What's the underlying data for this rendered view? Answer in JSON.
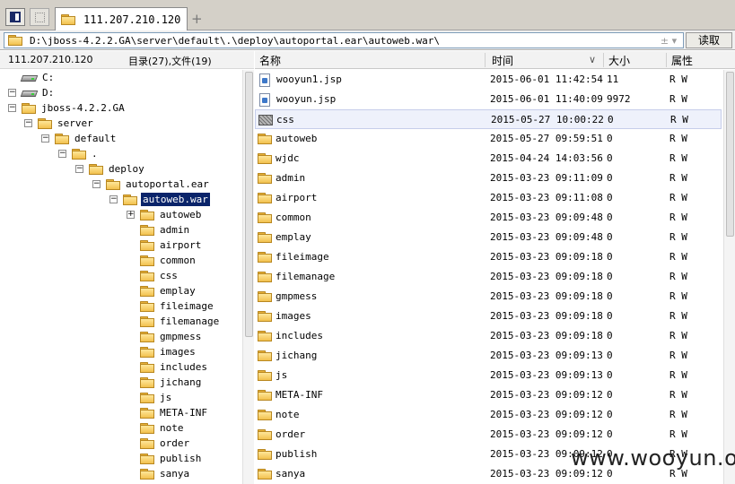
{
  "tab": {
    "title": "111.207.210.120",
    "add_label": "+"
  },
  "address": {
    "path": "D:\\jboss-4.2.2.GA\\server\\default\\.\\deploy\\autoportal.ear\\autoweb.war\\",
    "dropdown_glyph": "±  ▾",
    "read_button": "读取"
  },
  "status": {
    "host": "111.207.210.120",
    "counts": "目录(27),文件(19)"
  },
  "columns": {
    "name": "名称",
    "time": "时间",
    "size": "大小",
    "attr": "属性"
  },
  "tree": [
    {
      "label": "C:",
      "type": "drive",
      "exp": ""
    },
    {
      "label": "D:",
      "type": "drive",
      "exp": "−"
    },
    {
      "label": "jboss-4.2.2.GA",
      "type": "folder",
      "exp": "−"
    },
    {
      "label": "server",
      "type": "folder",
      "exp": "−"
    },
    {
      "label": "default",
      "type": "folder",
      "exp": "−"
    },
    {
      "label": ".",
      "type": "folder",
      "exp": "−"
    },
    {
      "label": "deploy",
      "type": "folder",
      "exp": "−"
    },
    {
      "label": "autoportal.ear",
      "type": "folder",
      "exp": "−"
    },
    {
      "label": "autoweb.war",
      "type": "folder",
      "exp": "−",
      "selected": true
    },
    {
      "label": "autoweb",
      "type": "folder",
      "exp": "+"
    },
    {
      "label": "admin",
      "type": "folder",
      "exp": ""
    },
    {
      "label": "airport",
      "type": "folder",
      "exp": ""
    },
    {
      "label": "common",
      "type": "folder",
      "exp": ""
    },
    {
      "label": "css",
      "type": "folder",
      "exp": ""
    },
    {
      "label": "emplay",
      "type": "folder",
      "exp": ""
    },
    {
      "label": "fileimage",
      "type": "folder",
      "exp": ""
    },
    {
      "label": "filemanage",
      "type": "folder",
      "exp": ""
    },
    {
      "label": "gmpmess",
      "type": "folder",
      "exp": ""
    },
    {
      "label": "images",
      "type": "folder",
      "exp": ""
    },
    {
      "label": "includes",
      "type": "folder",
      "exp": ""
    },
    {
      "label": "jichang",
      "type": "folder",
      "exp": ""
    },
    {
      "label": "js",
      "type": "folder",
      "exp": ""
    },
    {
      "label": "META-INF",
      "type": "folder",
      "exp": ""
    },
    {
      "label": "note",
      "type": "folder",
      "exp": ""
    },
    {
      "label": "order",
      "type": "folder",
      "exp": ""
    },
    {
      "label": "publish",
      "type": "folder",
      "exp": ""
    },
    {
      "label": "sanya",
      "type": "folder",
      "exp": ""
    }
  ],
  "files": [
    {
      "name": "wooyun1.jsp",
      "type": "file",
      "time": "2015-06-01 11:42:54",
      "size": "11",
      "attr": "R W"
    },
    {
      "name": "wooyun.jsp",
      "type": "file",
      "time": "2015-06-01 11:40:09",
      "size": "9972",
      "attr": "R W"
    },
    {
      "name": "css",
      "type": "css",
      "time": "2015-05-27 10:00:22",
      "size": "0",
      "attr": "R W",
      "highlight": true
    },
    {
      "name": "autoweb",
      "type": "folder",
      "time": "2015-05-27 09:59:51",
      "size": "0",
      "attr": "R W"
    },
    {
      "name": "wjdc",
      "type": "folder",
      "time": "2015-04-24 14:03:56",
      "size": "0",
      "attr": "R W"
    },
    {
      "name": "admin",
      "type": "folder",
      "time": "2015-03-23 09:11:09",
      "size": "0",
      "attr": "R W"
    },
    {
      "name": "airport",
      "type": "folder",
      "time": "2015-03-23 09:11:08",
      "size": "0",
      "attr": "R W"
    },
    {
      "name": "common",
      "type": "folder",
      "time": "2015-03-23 09:09:48",
      "size": "0",
      "attr": "R W"
    },
    {
      "name": "emplay",
      "type": "folder",
      "time": "2015-03-23 09:09:48",
      "size": "0",
      "attr": "R W"
    },
    {
      "name": "fileimage",
      "type": "folder",
      "time": "2015-03-23 09:09:18",
      "size": "0",
      "attr": "R W"
    },
    {
      "name": "filemanage",
      "type": "folder",
      "time": "2015-03-23 09:09:18",
      "size": "0",
      "attr": "R W"
    },
    {
      "name": "gmpmess",
      "type": "folder",
      "time": "2015-03-23 09:09:18",
      "size": "0",
      "attr": "R W"
    },
    {
      "name": "images",
      "type": "folder",
      "time": "2015-03-23 09:09:18",
      "size": "0",
      "attr": "R W"
    },
    {
      "name": "includes",
      "type": "folder",
      "time": "2015-03-23 09:09:18",
      "size": "0",
      "attr": "R W"
    },
    {
      "name": "jichang",
      "type": "folder",
      "time": "2015-03-23 09:09:13",
      "size": "0",
      "attr": "R W"
    },
    {
      "name": "js",
      "type": "folder",
      "time": "2015-03-23 09:09:13",
      "size": "0",
      "attr": "R W"
    },
    {
      "name": "META-INF",
      "type": "folder",
      "time": "2015-03-23 09:09:12",
      "size": "0",
      "attr": "R W"
    },
    {
      "name": "note",
      "type": "folder",
      "time": "2015-03-23 09:09:12",
      "size": "0",
      "attr": "R W"
    },
    {
      "name": "order",
      "type": "folder",
      "time": "2015-03-23 09:09:12",
      "size": "0",
      "attr": "R W"
    },
    {
      "name": "publish",
      "type": "folder",
      "time": "2015-03-23 09:09:12",
      "size": "0",
      "attr": "R W"
    },
    {
      "name": "sanya",
      "type": "folder",
      "time": "2015-03-23 09:09:12",
      "size": "0",
      "attr": "R W"
    }
  ],
  "watermark": "www.wooyun.org"
}
